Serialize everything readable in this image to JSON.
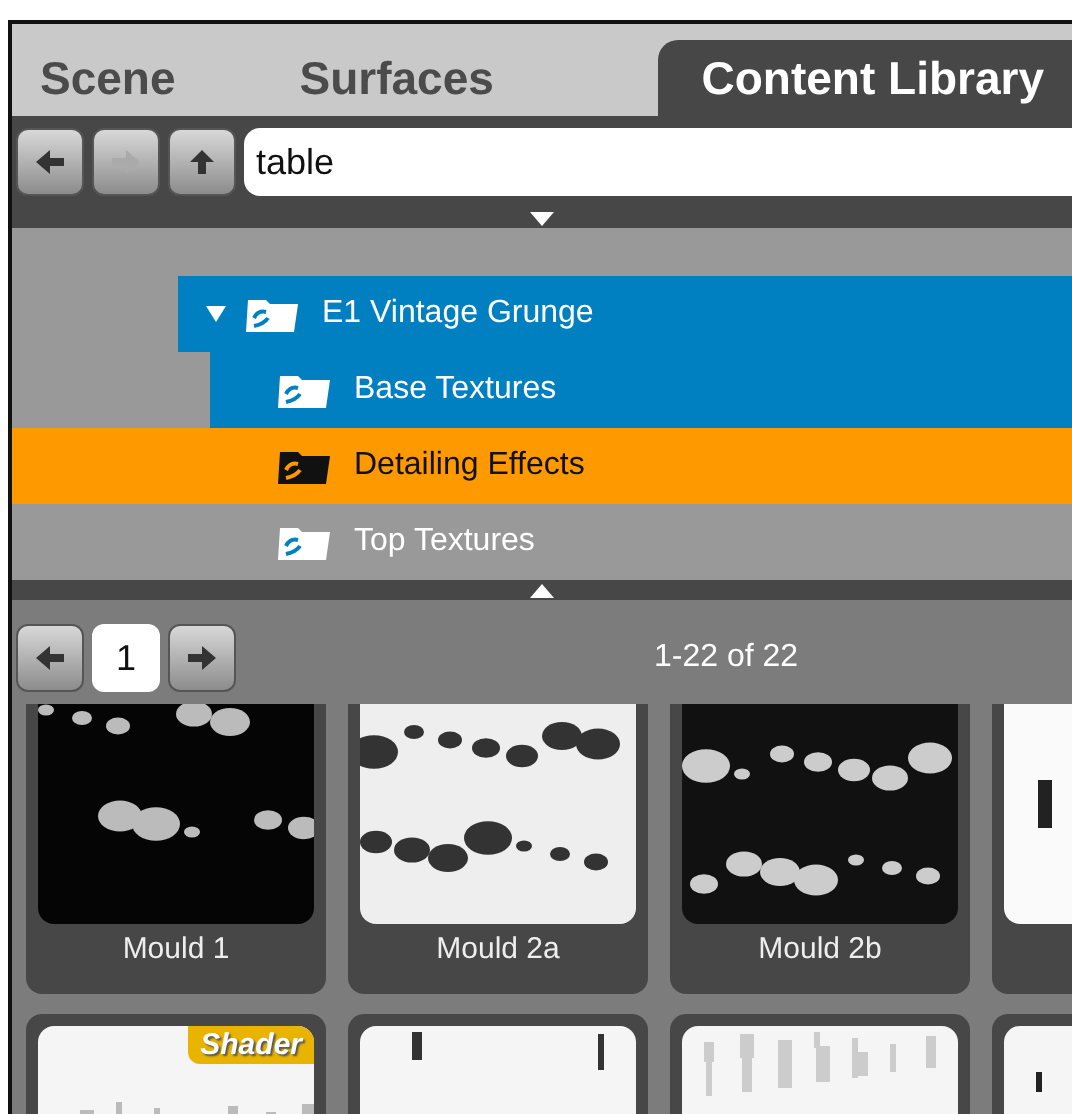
{
  "tabs": [
    {
      "label": "Scene",
      "selected": false
    },
    {
      "label": "Surfaces",
      "selected": false
    },
    {
      "label": "Content Library",
      "selected": true
    }
  ],
  "nav": {
    "back_disabled": false,
    "forward_disabled": true,
    "path": "table"
  },
  "tree": [
    {
      "label": "E1 Vintage Grunge",
      "expanded": true,
      "selected": true,
      "highlighted": false,
      "children": [
        {
          "label": "Base Textures",
          "selected": true,
          "highlighted": false
        },
        {
          "label": "Detailing Effects",
          "selected": false,
          "highlighted": true
        },
        {
          "label": "Top Textures",
          "selected": false,
          "highlighted": false
        }
      ]
    }
  ],
  "pager": {
    "page": "1",
    "range": "1-22 of 22"
  },
  "thumbnails": [
    {
      "label": "Mould 1",
      "shader": false
    },
    {
      "label": "Mould 2a",
      "shader": false
    },
    {
      "label": "Mould 2b",
      "shader": false
    },
    {
      "shader": false
    },
    {
      "shader": true,
      "badge": "Shader"
    },
    {
      "shader": false
    },
    {
      "shader": false
    },
    {
      "shader": false
    }
  ]
}
